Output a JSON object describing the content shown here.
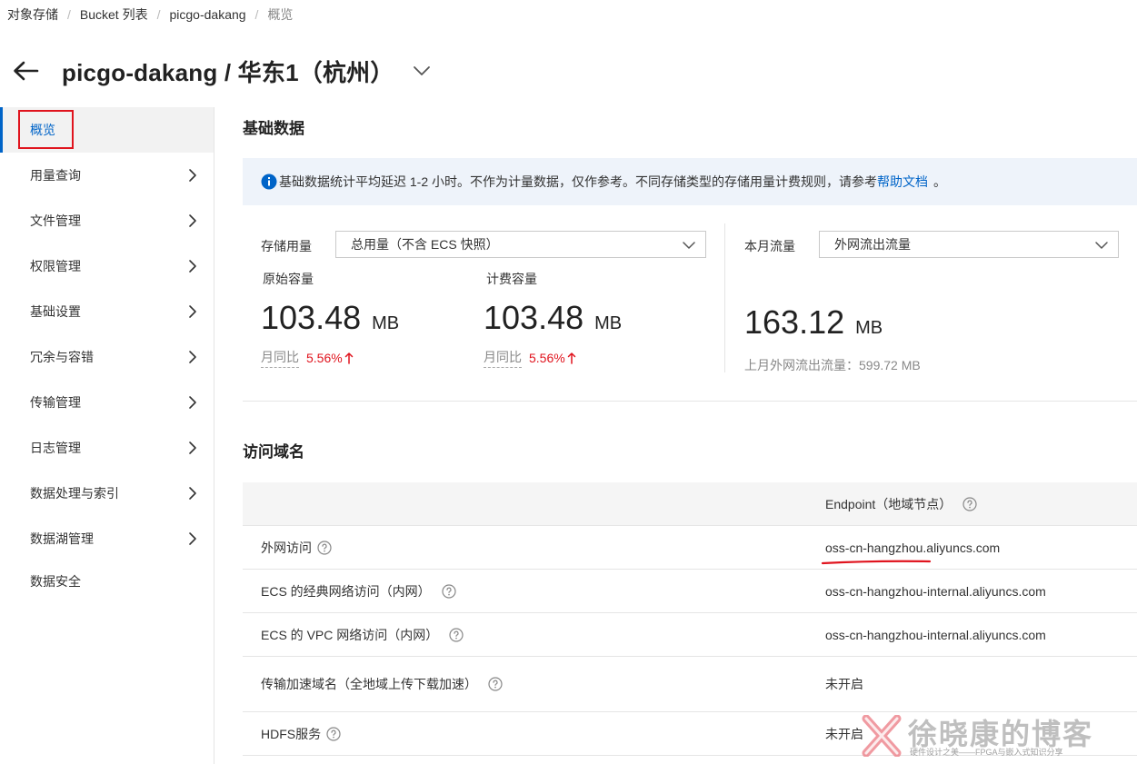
{
  "breadcrumb": [
    "对象存储",
    "Bucket 列表",
    "picgo-dakang",
    "概览"
  ],
  "header": {
    "title": "picgo-dakang / 华东1（杭州）"
  },
  "sidebar": {
    "items": [
      {
        "label": "概览"
      },
      {
        "label": "用量查询"
      },
      {
        "label": "文件管理"
      },
      {
        "label": "权限管理"
      },
      {
        "label": "基础设置"
      },
      {
        "label": "冗余与容错"
      },
      {
        "label": "传输管理"
      },
      {
        "label": "日志管理"
      },
      {
        "label": "数据处理与索引"
      },
      {
        "label": "数据湖管理"
      },
      {
        "label": "数据安全"
      }
    ]
  },
  "basic": {
    "title": "基础数据",
    "notice_text": "基础数据统计平均延迟 1-2 小时。不作为计量数据，仅作参考。不同存储类型的存储用量计费规则，请参考",
    "notice_link": "帮助文档",
    "notice_end": "。",
    "storage_label": "存储用量",
    "storage_select": "总用量（不含 ECS 快照）",
    "traffic_label": "本月流量",
    "traffic_select": "外网流出流量",
    "original": {
      "label": "原始容量",
      "value": "103.48",
      "unit": "MB",
      "yoy_label": "月同比",
      "yoy_pct": "5.56%"
    },
    "billing": {
      "label": "计费容量",
      "value": "103.48",
      "unit": "MB",
      "yoy_label": "月同比",
      "yoy_pct": "5.56%"
    },
    "traffic": {
      "value": "163.12",
      "unit": "MB",
      "last_month": "上月外网流出流量：599.72 MB"
    }
  },
  "domains": {
    "title": "访问域名",
    "header_col2": "Endpoint（地域节点）",
    "rows": [
      {
        "name": "外网访问",
        "endpoint": "oss-cn-hangzhou.aliyuncs.com"
      },
      {
        "name": "ECS 的经典网络访问（内网）",
        "endpoint": "oss-cn-hangzhou-internal.aliyuncs.com"
      },
      {
        "name": "ECS 的 VPC 网络访问（内网）",
        "endpoint": "oss-cn-hangzhou-internal.aliyuncs.com"
      },
      {
        "name": "传输加速域名（全地域上传下载加速）",
        "endpoint": "未开启"
      },
      {
        "name": "HDFS服务",
        "endpoint": "未开启"
      }
    ]
  },
  "watermark": {
    "title": "徐晓康的博客",
    "subtitle": "硬件设计之美——FPGA与嵌入式知识分享"
  },
  "colors": {
    "accent": "#0064c8",
    "alert_red": "#e0141e",
    "notice_bg": "#eef3fa"
  },
  "icons": [
    "back-arrow-icon",
    "chevron-down-icon",
    "chevron-right-icon",
    "info-icon",
    "help-icon",
    "up-arrow-icon"
  ]
}
